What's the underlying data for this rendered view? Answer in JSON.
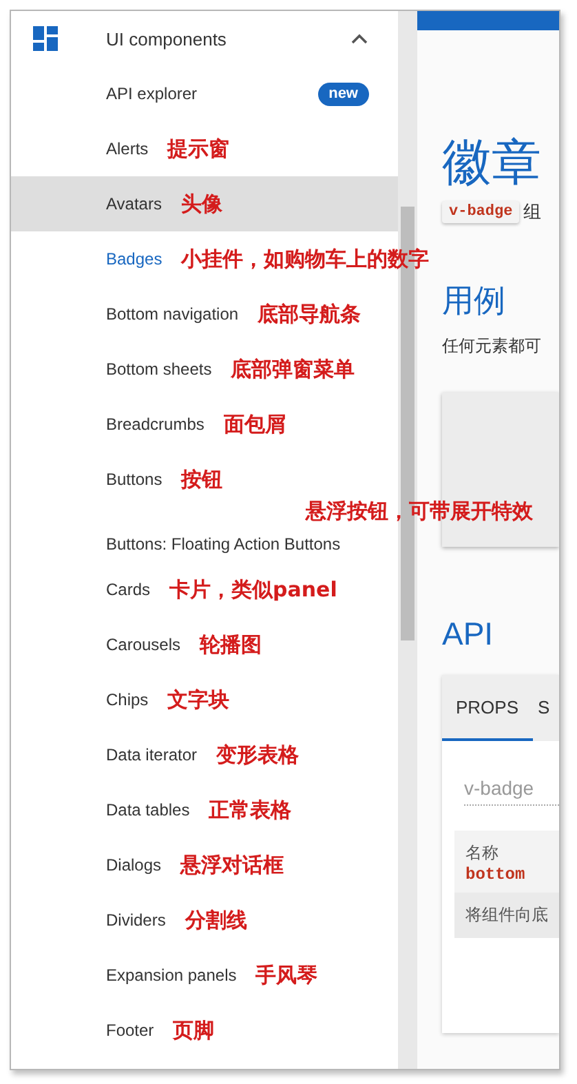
{
  "nav": {
    "group": {
      "label": "UI components",
      "expanded": true
    },
    "items": [
      {
        "label": "API explorer",
        "badge": "new",
        "hovered": false,
        "selected": false
      },
      {
        "label": "Alerts",
        "note": "提示窗",
        "hovered": false,
        "selected": false
      },
      {
        "label": "Avatars",
        "note": "头像",
        "hovered": true,
        "selected": false
      },
      {
        "label": "Badges",
        "note": "小挂件，如购物车上的数字",
        "hovered": false,
        "selected": true
      },
      {
        "label": "Bottom navigation",
        "note": "底部导航条",
        "hovered": false,
        "selected": false
      },
      {
        "label": "Bottom sheets",
        "note": "底部弹窗菜单",
        "hovered": false,
        "selected": false
      },
      {
        "label": "Breadcrumbs",
        "note": "面包屑",
        "hovered": false,
        "selected": false
      },
      {
        "label": "Buttons",
        "note": "按钮",
        "hovered": false,
        "selected": false
      },
      {
        "label": "Buttons: Floating Action Buttons",
        "floating_note": "悬浮按钮，可带展开特效",
        "hovered": false,
        "selected": false
      },
      {
        "label": "Cards",
        "note": "卡片，类似panel",
        "hovered": false,
        "selected": false
      },
      {
        "label": "Carousels",
        "note": "轮播图",
        "hovered": false,
        "selected": false
      },
      {
        "label": "Chips",
        "note": "文字块",
        "hovered": false,
        "selected": false
      },
      {
        "label": "Data iterator",
        "note": "变形表格",
        "hovered": false,
        "selected": false
      },
      {
        "label": "Data tables",
        "note": "正常表格",
        "hovered": false,
        "selected": false
      },
      {
        "label": "Dialogs",
        "note": "悬浮对话框",
        "hovered": false,
        "selected": false
      },
      {
        "label": "Dividers",
        "note": "分割线",
        "hovered": false,
        "selected": false
      },
      {
        "label": "Expansion panels",
        "note": "手风琴",
        "hovered": false,
        "selected": false
      },
      {
        "label": "Footer",
        "note": "页脚",
        "hovered": false,
        "selected": false
      }
    ]
  },
  "page": {
    "title": "徽章",
    "intro_code": "v-badge",
    "intro_text": "组",
    "usage_heading": "用例",
    "usage_text": "任何元素都可",
    "api_heading": "API",
    "tabs": [
      {
        "label": "PROPS",
        "selected": true
      },
      {
        "label": "S",
        "selected": false
      }
    ],
    "search": {
      "value": "v-badge"
    },
    "table": {
      "header": "名称",
      "prop": "bottom",
      "description": "将组件向底"
    }
  }
}
